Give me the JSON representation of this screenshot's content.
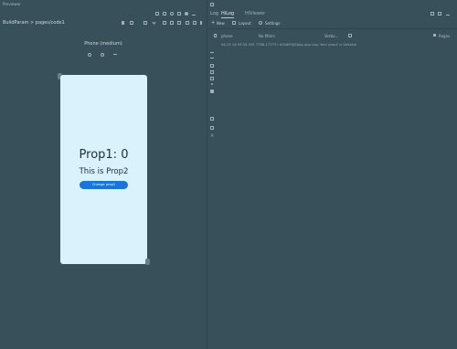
{
  "window": {
    "previewer_title": "Previewer"
  },
  "previewer": {
    "breadcrumb": "BuildParam > pages/code1",
    "device_label": "Phone (medium)",
    "app": {
      "prop1_text": "Prop1: 0",
      "prop2_text": "This is Prop2",
      "button_label": "Change prop1"
    }
  },
  "log_panel": {
    "tabs": [
      {
        "label": "Log"
      },
      {
        "label": "HiLog"
      },
      {
        "label": "HiViewer"
      }
    ],
    "toolbar": {
      "new_label": "New",
      "layout_label": "Layout",
      "settings_label": "Settings"
    },
    "filters": {
      "device": "phone",
      "process": "No filters",
      "level": "Verbo...",
      "regex_label": "Regex"
    },
    "log_line": "06-25 16:59:34.555 7788-17175 I A03d00/JSApp app Log: Your prop1 is Variable"
  },
  "colors": {
    "background": "#37505a",
    "phone_screen": "#d9f2fb",
    "button": "#1976d2",
    "tab_underline": "#9fd0e6"
  }
}
